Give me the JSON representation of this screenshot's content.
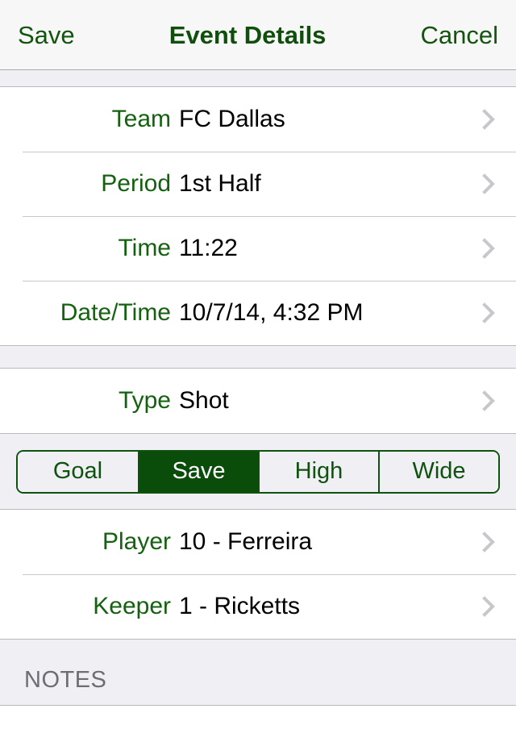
{
  "navbar": {
    "left_button": "Save",
    "title": "Event Details",
    "right_button": "Cancel"
  },
  "sections": {
    "details": {
      "rows": [
        {
          "label": "Team",
          "value": "FC Dallas"
        },
        {
          "label": "Period",
          "value": "1st Half"
        },
        {
          "label": "Time",
          "value": "11:22"
        },
        {
          "label": "Date/Time",
          "value": "10/7/14, 4:32 PM"
        }
      ]
    },
    "type": {
      "rows": [
        {
          "label": "Type",
          "value": "Shot"
        }
      ]
    },
    "outcome": {
      "segments": [
        {
          "label": "Goal",
          "selected": false
        },
        {
          "label": "Save",
          "selected": true
        },
        {
          "label": "High",
          "selected": false
        },
        {
          "label": "Wide",
          "selected": false
        }
      ]
    },
    "people": {
      "rows": [
        {
          "label": "Player",
          "value": "10 - Ferreira"
        },
        {
          "label": "Keeper",
          "value": "1 - Ricketts"
        }
      ]
    },
    "notes": {
      "header": "NOTES"
    }
  },
  "icons": {
    "disclosure": "chevron-right-icon"
  },
  "colors": {
    "accent_green": "#14610f",
    "selected_green": "#0a4c0a",
    "group_background": "#efeff4",
    "separator": "#c8c7cc",
    "chevron_grey": "#c7c7cc",
    "header_text_grey": "#6d6d72"
  }
}
